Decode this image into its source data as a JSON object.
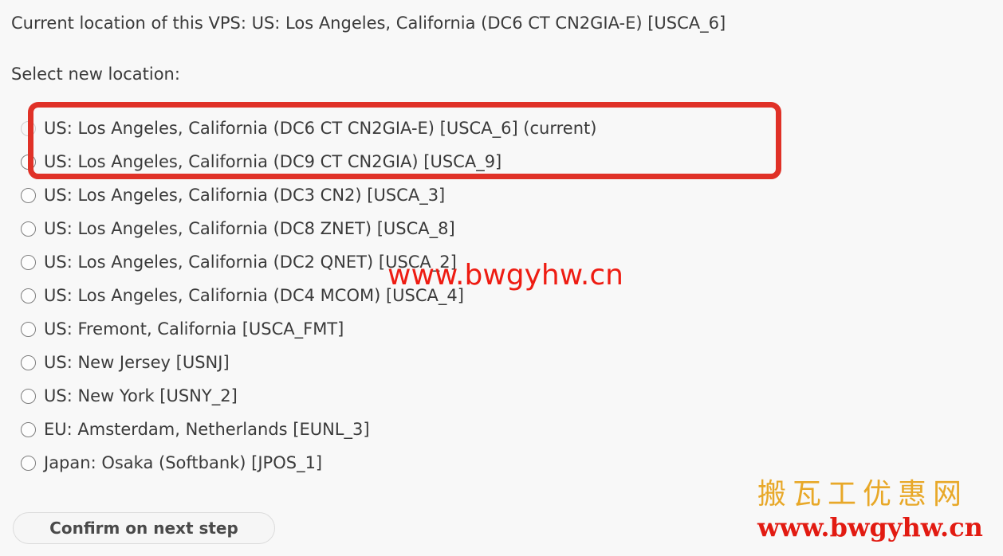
{
  "header": {
    "current_location_text": "Current location of this VPS: US: Los Angeles, California (DC6 CT CN2GIA-E) [USCA_6]",
    "select_label": "Select new location:"
  },
  "options": [
    {
      "label": "US: Los Angeles, California (DC6 CT CN2GIA-E) [USCA_6] (current)",
      "selected": false,
      "faded": true
    },
    {
      "label": "US: Los Angeles, California (DC9 CT CN2GIA) [USCA_9]",
      "selected": false,
      "faded": false
    },
    {
      "label": "US: Los Angeles, California (DC3 CN2) [USCA_3]",
      "selected": false,
      "faded": false
    },
    {
      "label": "US: Los Angeles, California (DC8 ZNET) [USCA_8]",
      "selected": false,
      "faded": false
    },
    {
      "label": "US: Los Angeles, California (DC2 QNET) [USCA_2]",
      "selected": false,
      "faded": false
    },
    {
      "label": "US: Los Angeles, California (DC4 MCOM) [USCA_4]",
      "selected": false,
      "faded": false
    },
    {
      "label": "US: Fremont, California [USCA_FMT]",
      "selected": false,
      "faded": false
    },
    {
      "label": "US: New Jersey [USNJ]",
      "selected": false,
      "faded": false
    },
    {
      "label": "US: New York [USNY_2]",
      "selected": false,
      "faded": false
    },
    {
      "label": "EU: Amsterdam, Netherlands [EUNL_3]",
      "selected": false,
      "faded": false
    },
    {
      "label": "Japan: Osaka (Softbank) [JPOS_1]",
      "selected": false,
      "faded": false
    }
  ],
  "annotation": {
    "color": "#e03127",
    "covers_options": [
      0,
      1
    ]
  },
  "button": {
    "confirm_label": "Confirm on next step"
  },
  "watermarks": {
    "center_url": "www.bwgyhw.cn",
    "center_color": "#ee1c12",
    "corner_chinese": "搬瓦工优惠网",
    "corner_chinese_color": "#e8a828",
    "corner_url": "www.bwgyhw.cn",
    "corner_url_color": "#e21b12"
  }
}
